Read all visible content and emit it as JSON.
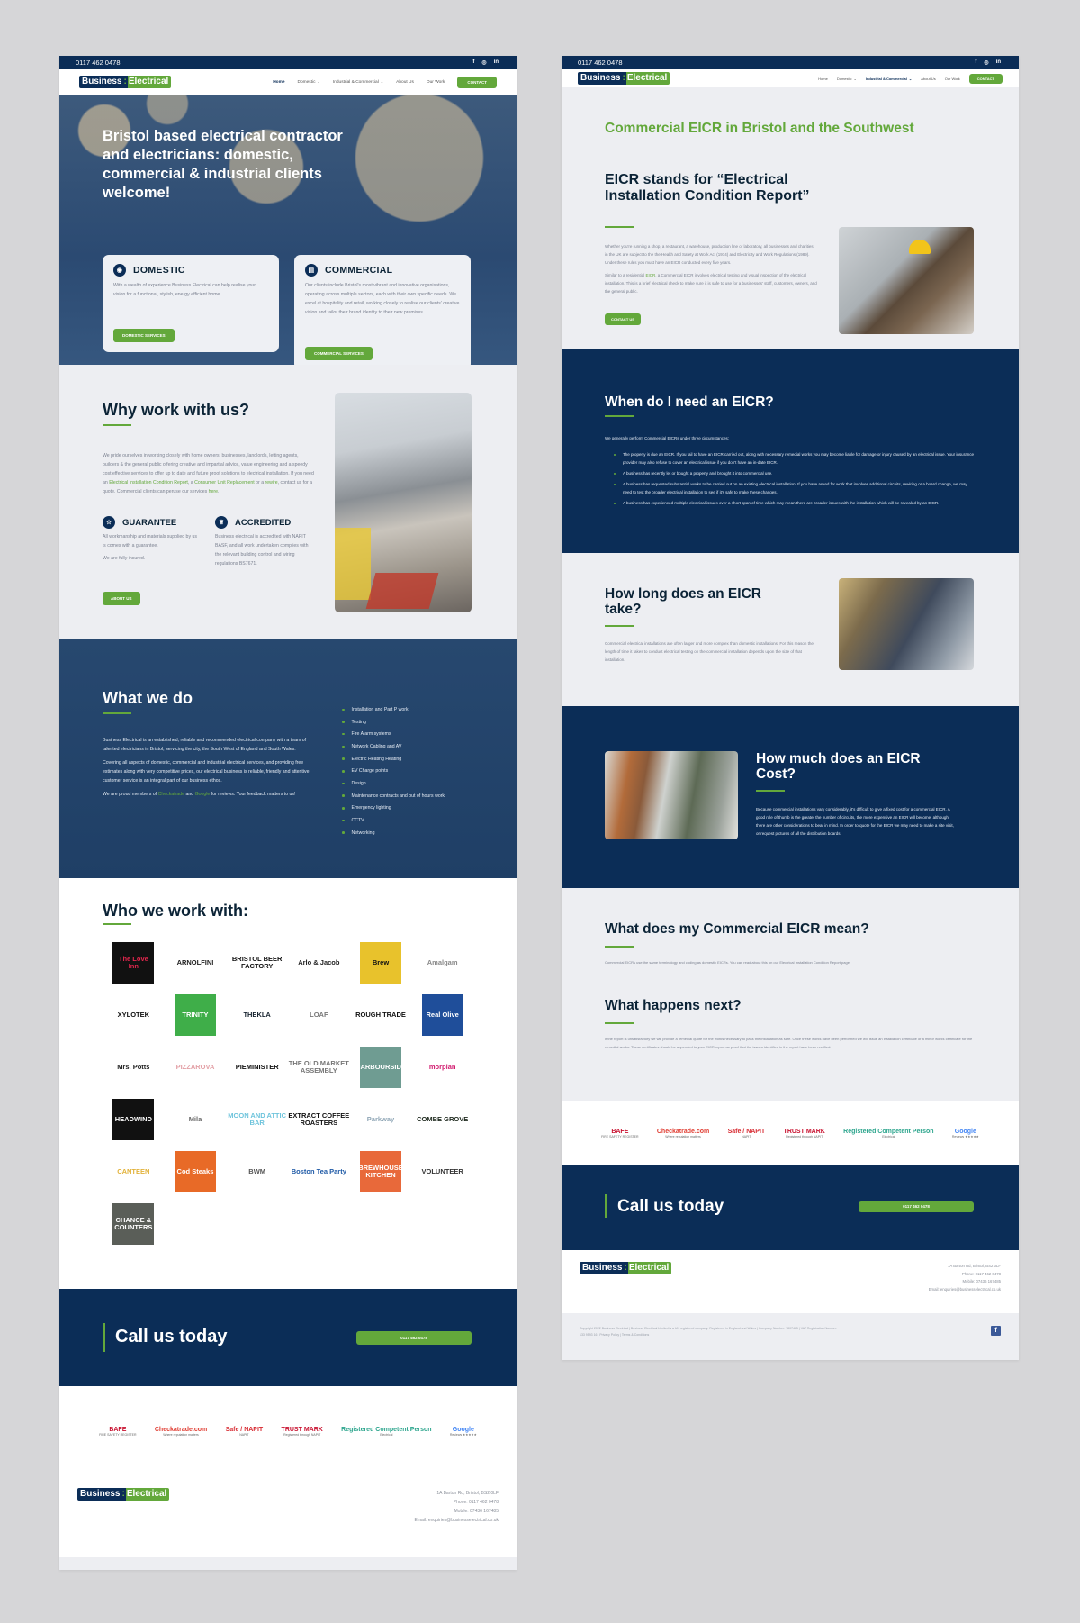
{
  "site": {
    "phone": "0117 462 0478",
    "logo": {
      "part1": "Business",
      "sep": ":",
      "part2": "Electrical"
    },
    "social": [
      "f",
      "◎",
      "in"
    ],
    "nav": [
      {
        "label": "Home",
        "caret": false
      },
      {
        "label": "Domestic",
        "caret": true
      },
      {
        "label": "Industrial & Commercial",
        "caret": true
      },
      {
        "label": "About Us",
        "caret": false
      },
      {
        "label": "Our Work",
        "caret": false
      }
    ],
    "contact_label": "CONTACT",
    "colors": {
      "navy": "#0b2d57",
      "green": "#63a83b",
      "bg": "#edeef2"
    }
  },
  "home": {
    "hero": {
      "title": "Bristol based electrical contractor and electricians: domestic, commercial & industrial clients welcome!",
      "cards": [
        {
          "icon": "lightbulb-icon",
          "title": "DOMESTIC",
          "text": "With a wealth of experience Business Electrical can help realise your vision for a functional, stylish, energy efficient home.",
          "button": "DOMESTIC SERVICES"
        },
        {
          "icon": "building-icon",
          "title": "COMMERCIAL",
          "text": "Our clients include Bristol's most vibrant and innovative organisations, operating across multiple sectors, each with their own specific needs. We excel at hospitality and retail, working closely to realise our clients' creative vision and tailor their brand identity to their new premises.",
          "button": "COMMERCIAL SERVICES"
        }
      ]
    },
    "why": {
      "title": "Why work with us?",
      "text_before": "We pride ourselves in working closely with home owners, businesses, landlords, letting agents, builders & the general public offering creative and impartial advice, value engineering and a speedy cost effective services to offer up to date and future proof solutions to electrical installation. If you need an ",
      "link1": "Electrical Installation Condition Report",
      "text_mid1": ", a ",
      "link2": "Consumer Unit Replacement",
      "text_mid2": " or a ",
      "link3": "rewire",
      "text_mid3": ", contact us for a quote. Commercial clients can peruse our services ",
      "link4": "here",
      "text_end": ".",
      "features": [
        {
          "title": "GUARANTEE",
          "lines": [
            "All workmanship and materials supplied by us is comes with a guarantee.",
            "We are fully insured."
          ]
        },
        {
          "title": "ACCREDITED",
          "lines": [
            "Business electrical is accredited with NAPIT BASF, and all work undertaken complies with the relevant building control and wiring regulations BS7671."
          ]
        }
      ],
      "button": "ABOUT US"
    },
    "what": {
      "title": "What we do",
      "p1": "Business Electrical is an established, reliable and recommended electrical company with a team of talented electricians in Bristol, servicing the city, the South West of England and South Wales.",
      "p2": "Covering all aspects of domestic, commercial and industrial electrical services, and providing free estimates along with very competitive prices, our electrical business is reliable, friendly and attentive customer service is an integral part of our business ethos.",
      "p3_before": "We are proud members of ",
      "p3_link1": "Checkatrade",
      "p3_mid": " and ",
      "p3_link2": "Google",
      "p3_after": " for reviews. Your feedback matters to us!",
      "services": [
        "Installation and Part P work",
        "Testing",
        "Fire Alarm systems",
        "Network Cabling and AV",
        "Electric Heating Heating",
        "EV Charge points",
        "Design",
        "Maintenance contracts and out of hours work",
        "Emergency lighting",
        "CCTV",
        "Networking"
      ]
    },
    "who": {
      "title": "Who we work with:",
      "clients": [
        {
          "name": "The Love Inn",
          "bg": "#111",
          "fg": "#e2264d"
        },
        {
          "name": "ARNOLFINI",
          "bg": "",
          "fg": "#222"
        },
        {
          "name": "BRISTOL BEER FACTORY",
          "bg": "",
          "fg": "#111"
        },
        {
          "name": "Arlo & Jacob",
          "bg": "",
          "fg": "#222"
        },
        {
          "name": "Brew",
          "bg": "#e8c22c",
          "fg": "#111"
        },
        {
          "name": "Amalgam",
          "bg": "",
          "fg": "#888"
        },
        {
          "name": "XYLOTEK",
          "bg": "",
          "fg": "#111"
        },
        {
          "name": "TRINITY",
          "bg": "#3fae49",
          "fg": "#fff"
        },
        {
          "name": "THEKLA",
          "bg": "",
          "fg": "#16222e"
        },
        {
          "name": "LOAF",
          "bg": "",
          "fg": "#777"
        },
        {
          "name": "ROUGH TRADE",
          "bg": "",
          "fg": "#111"
        },
        {
          "name": "Real Olive",
          "bg": "#1f4e9a",
          "fg": "#fff"
        },
        {
          "name": "Mrs. Potts",
          "bg": "",
          "fg": "#222"
        },
        {
          "name": "PIZZAROVA",
          "bg": "",
          "fg": "#e3a0a6"
        },
        {
          "name": "PIEMINISTER",
          "bg": "",
          "fg": "#111"
        },
        {
          "name": "THE OLD MARKET ASSEMBLY",
          "bg": "",
          "fg": "#777"
        },
        {
          "name": "HARBOURSIDE",
          "bg": "#6f9c92",
          "fg": "#fff"
        },
        {
          "name": "morplan",
          "bg": "",
          "fg": "#d11a6e"
        },
        {
          "name": "HEADWIND",
          "bg": "#111",
          "fg": "#fff"
        },
        {
          "name": "Mila",
          "bg": "",
          "fg": "#666"
        },
        {
          "name": "MOON AND ATTIC BAR",
          "bg": "",
          "fg": "#6ec4dc"
        },
        {
          "name": "EXTRACT COFFEE ROASTERS",
          "bg": "",
          "fg": "#111"
        },
        {
          "name": "Parkway",
          "bg": "",
          "fg": "#8fa6b6"
        },
        {
          "name": "COMBE GROVE",
          "bg": "",
          "fg": "#1f2a1f"
        },
        {
          "name": "CANTEEN",
          "bg": "",
          "fg": "#e2b23a"
        },
        {
          "name": "Cod Steaks",
          "bg": "#e86a27",
          "fg": "#fff"
        },
        {
          "name": "BWM",
          "bg": "",
          "fg": "#555"
        },
        {
          "name": "Boston Tea Party",
          "bg": "",
          "fg": "#1f5aa6"
        },
        {
          "name": "BREWHOUSE KITCHEN",
          "bg": "#e8693a",
          "fg": "#fff"
        },
        {
          "name": "VOLUNTEER",
          "bg": "",
          "fg": "#333"
        },
        {
          "name": "CHANCE & COUNTERS",
          "bg": "#5a5e58",
          "fg": "#fff"
        }
      ]
    }
  },
  "eicr": {
    "page_title": "Commercial EICR in Bristol and the Southwest",
    "intro": {
      "title": "EICR stands for “Electrical Installation Condition Report”",
      "p1": "Whether you're running a shop, a restaurant, a warehouse, production line or laboratory, all businesses and charities in the UK are subject to the the Health and Safety at Work Act (1974) and Electricity and Work Regulations (1989). Under these rules you must have an EICR conducted every five years.",
      "p2_before": "Similar to a residential ",
      "p2_link": "EICR",
      "p2_after": ", a Commercial EICR involves electrical testing and visual inspection of the electrical installation. This is a brief electrical check to make sure it is safe to use for a businesses' staff, customers, owners, and the general public.",
      "button": "CONTACT US"
    },
    "when": {
      "title": "When do I need an EICR?",
      "intro": "We generally perform Commercial EICRs under three circumstances:",
      "items": [
        "The property is due an EICR. If you fail to have an EICR carried out, along with necessary remedial works you may become liable for damage or injury caused by an electrical issue. Your insurance provider may also refuse to cover an electrical issue if you don't have an in-date EICR.",
        "A business has recently let or bought a property and brought it into commercial use.",
        "A business has requested substantial works to be carried out on an existing electrical installation. If you have asked for work that involves additional circuits, rewiring or a board change, we may need to test the broader electrical installation to see if it's safe to make these changes.",
        "A business has experienced multiple electrical issues over a short span of time which may mean there are broader issues with the installation which will be revealed by an EICR."
      ]
    },
    "howlong": {
      "title": "How long does an EICR take?",
      "text": "Commercial electrical installations are often larger and more complex than domestic installations. For this reason the length of time it takes to conduct electrical testing on the commercial installation depends upon the size of that installation."
    },
    "howmuch": {
      "title": "How much does an EICR Cost?",
      "text": "Because commercial installations vary considerably, it's difficult to give a fixed cost for a commercial EICR. A good rule of thumb is the greater the number of circuits, the more expensive an EICR will become, although there are other considerations to bear in mind. In order to quote for the EICR we may need to make a site visit, or request pictures of all the distribution boards."
    },
    "mean": {
      "title": "What does my Commercial EICR mean?",
      "text": "Commercial EICRs use the same terminology and coding as domestic EICRs. You can read about this on our Electrical Installation Condition Report page."
    },
    "next": {
      "title": "What happens next?",
      "text": "If the report is unsatisfactory we will provide a remedial quote for the works necessary to pass the installation as safe. Once these works have been performed we will issue an installation certificate or a minor works certificate for the remedial works. These certificates should be appended to your EICR report as proof that the issues identified in the report have been rectified."
    }
  },
  "shared": {
    "call_title": "Call us today",
    "call_button": "0117 462 0478",
    "accreditations": [
      {
        "name": "BAFE",
        "sub": "FIRE SAFETY REGISTER",
        "color": "#c8102e"
      },
      {
        "name": "Checkatrade.com",
        "sub": "Where reputation matters",
        "color": "#e03c31"
      },
      {
        "name": "Safe / NAPIT",
        "sub": "NAPIT",
        "color": "#d7282f"
      },
      {
        "name": "TRUST MARK",
        "sub": "Registered through NAPIT",
        "color": "#c8102e"
      },
      {
        "name": "Registered Competent Person",
        "sub": "Electrical",
        "color": "#2ca58d"
      },
      {
        "name": "Google",
        "sub": "Reviews ★★★★★",
        "color": "#4285f4"
      }
    ],
    "footer": {
      "address": "1A Barton Rd, Bristol, BS2 0LF",
      "phone": "Phone: 0117 462 0478",
      "mobile": "Mobile: 07436 167485",
      "email": "Email: enquiries@businesselectrical.co.uk",
      "copyright": "Copyright 2022 Business Electrical | Business Electrical Limited is a UK registered company. Registered in England and Wales | Company Number: 7807465 | VAT Registration Number: 133 9593 16 | Privacy Policy | Terms & Conditions",
      "fb": "f"
    }
  }
}
